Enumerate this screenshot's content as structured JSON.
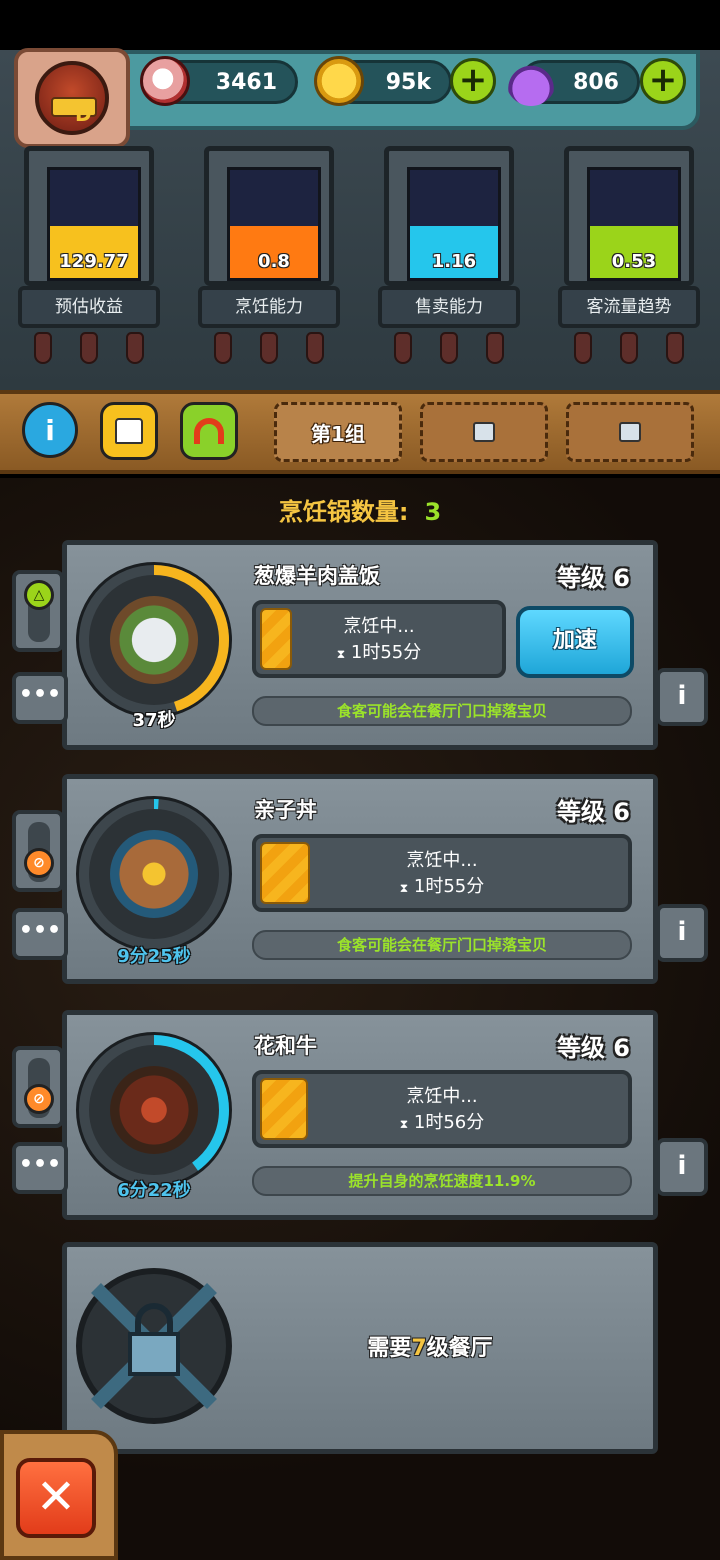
{
  "resources": {
    "eyes": "3461",
    "coins": "95k",
    "potions": "806"
  },
  "avatar": {
    "badge": "D"
  },
  "stats": [
    {
      "value": "129.77",
      "label": "预估收益",
      "color": "#f7c11e"
    },
    {
      "value": "0.8",
      "label": "烹饪能力",
      "color": "#ff7a12"
    },
    {
      "value": "1.16",
      "label": "售卖能力",
      "color": "#25c6ec"
    },
    {
      "value": "0.53",
      "label": "客流量趋势",
      "color": "#9bd41a"
    }
  ],
  "toolbar": {
    "tabs": [
      "第1组"
    ]
  },
  "pot_count": {
    "label": "烹饪锅数量:",
    "value": "3"
  },
  "dishes": [
    {
      "name": "葱爆羊肉盖饭",
      "level": "等级 6",
      "status": "烹饪中...",
      "time": "1时55分",
      "timer": "37秒",
      "effect": "食客可能会在餐厅门口掉落宝贝",
      "speed_label": "加速",
      "ring_color": "#f7b51e",
      "ring_progress": 0.45
    },
    {
      "name": "亲子丼",
      "level": "等级 6",
      "status": "烹饪中...",
      "time": "1时55分",
      "timer": "9分25秒",
      "effect": "食客可能会在餐厅门口掉落宝贝",
      "ring_color": "#25c6ec",
      "ring_progress": 0.01
    },
    {
      "name": "花和牛",
      "level": "等级 6",
      "status": "烹饪中...",
      "time": "1时56分",
      "timer": "6分22秒",
      "effect": "提升自身的烹饪速度11.9%",
      "ring_color": "#25c6ec",
      "ring_progress": 0.4
    }
  ],
  "locked": {
    "prefix": "需要",
    "level": "7",
    "suffix": "级餐厅"
  },
  "icons": {
    "info": "i",
    "more": "•••",
    "close": "✕",
    "plus": "+"
  }
}
